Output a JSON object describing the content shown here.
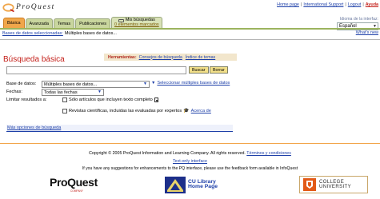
{
  "header": {
    "logo_text": "ProQuest",
    "toplinks": {
      "home": "Home page",
      "support": "International Support",
      "logout": "Logout",
      "help": "Ayuda",
      "sep": "|"
    }
  },
  "tabs": {
    "basica": "Básica",
    "avanzada": "Avanzada",
    "temas": "Temas",
    "publicaciones": "Publicaciones",
    "mis_busquedas": "Mis búsquedas",
    "elementos_marcados": "0 elementos marcados"
  },
  "language": {
    "label": "Idioma de la interfaz:",
    "selected": "Español"
  },
  "db_line": {
    "link": "Bases de datos seleccionadas:",
    "text": "Múltiples bases de datos..."
  },
  "whats_new": "What's new",
  "page": {
    "title": "Búsqueda básica"
  },
  "tools": {
    "label": "Herramientas:",
    "tips": "Consejos de búsqueda",
    "topics": "Índice de temas"
  },
  "search": {
    "value": "",
    "buscar": "Buscar",
    "borrar": "Borrar"
  },
  "form": {
    "bases_label": "Base de datos:",
    "bases_value": "Múltiples bases de datos...",
    "bases_link": "Seleccionar múltiples bases de datos",
    "fechas_label": "Fechas:",
    "fechas_value": "Todas las fechas",
    "limit_label": "Limitar resultados a:",
    "chk_full": "Sólo artículos que incluyen texto completo",
    "chk_peer": "Revistas científicas, incluidas las evaluadas por expertos",
    "about_link": "Acerca de"
  },
  "more_options": "Más opciones de búsqueda",
  "footer": {
    "copyright": "Copyright © 2005 ProQuest Information and Learning Company. All rights reserved.",
    "terms": "Términos y condiciones",
    "text_only": "Text-only interface",
    "feedback": "If you have any suggestions for enhancements to the PQ interface, please use the feedback form available in InfoQuest"
  },
  "logos": {
    "pq_pro": "Pro",
    "pq_q": "Q",
    "pq_uest": "uest",
    "pq_sub": "COMPANY",
    "cu_line1": "CU Library",
    "cu_line2": "Home Page",
    "col_line1": "COLLEGE",
    "col_line2": "UNIVERSITY"
  },
  "colors": {
    "accent_red": "#c4201a",
    "link_blue": "#1d3fa8",
    "tab_green": "#c9d69e",
    "tab_active": "#f0a64a",
    "footer_rule": "#f2a54b"
  }
}
